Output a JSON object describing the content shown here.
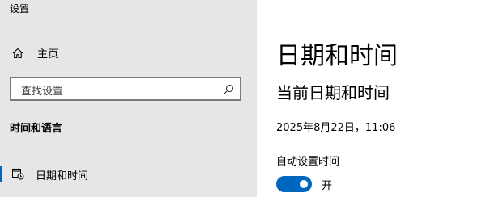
{
  "window": {
    "title": "设置"
  },
  "sidebar": {
    "home": {
      "label": "主页",
      "icon": "home-icon"
    },
    "search": {
      "placeholder": "查找设置",
      "icon": "search-icon"
    },
    "section_heading": "时间和语言",
    "items": [
      {
        "label": "日期和时间",
        "icon": "calendar-clock-icon",
        "selected": true
      }
    ]
  },
  "main": {
    "page_title": "日期和时间",
    "sub_title": "当前日期和时间",
    "current_datetime": "2025年8月22日，11:06",
    "auto_time": {
      "label": "自动设置时间",
      "state_label": "开",
      "on": true
    }
  },
  "colors": {
    "accent": "#0067c0",
    "sidebar_bg": "#e6e6e6",
    "main_bg": "#ffffff"
  }
}
